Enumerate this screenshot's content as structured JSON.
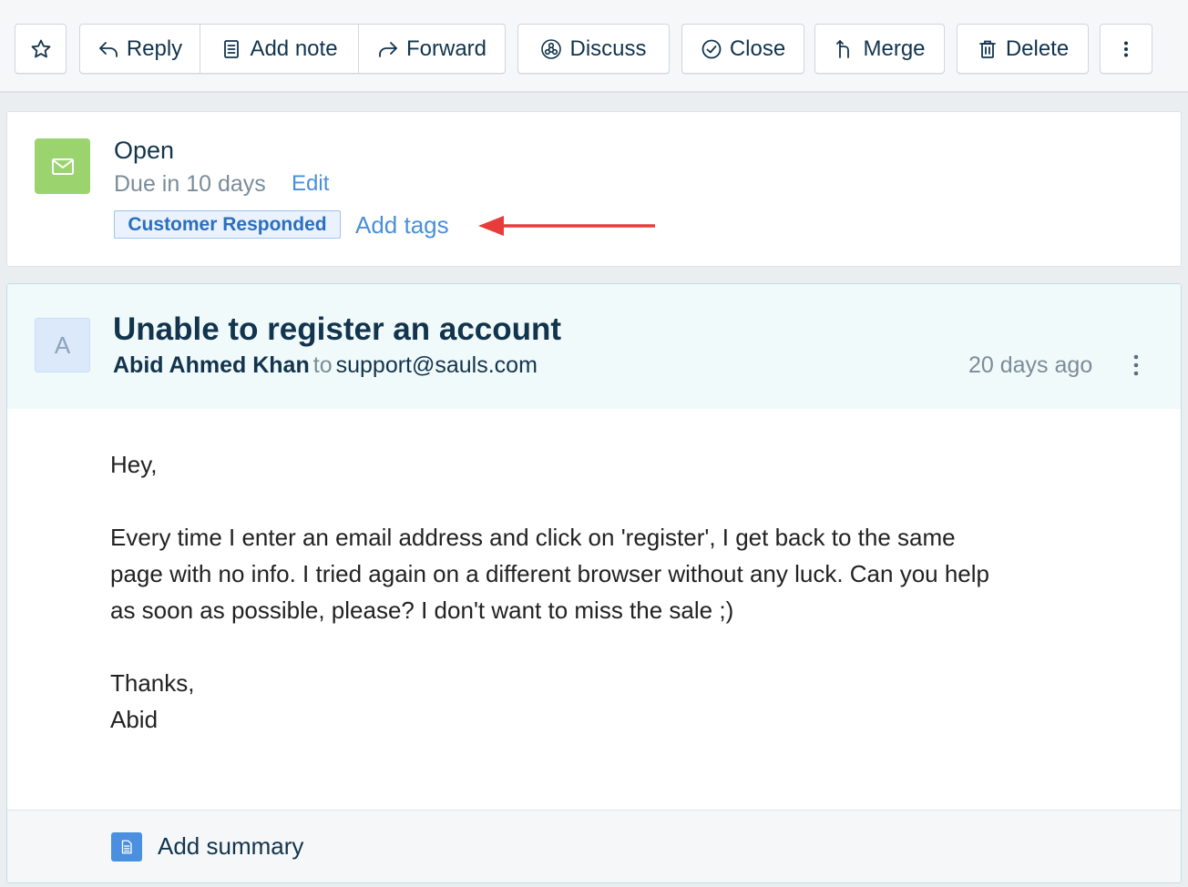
{
  "toolbar": {
    "star_icon": "star-icon",
    "reply_label": "Reply",
    "add_note_label": "Add note",
    "forward_label": "Forward",
    "discuss_label": "Discuss",
    "close_label": "Close",
    "merge_label": "Merge",
    "delete_label": "Delete",
    "more_icon": "more-vertical-icon"
  },
  "status": {
    "title": "Open",
    "due": "Due in 10 days",
    "edit_label": "Edit",
    "tag": "Customer Responded",
    "add_tags_label": "Add tags",
    "icon_color": "#9bd46f",
    "annotation_arrow_color": "#e83c3c"
  },
  "conversation": {
    "avatar_initial": "A",
    "subject": "Unable to register an account",
    "from_name": "Abid Ahmed Khan",
    "to_word": "to",
    "to_address": "support@sauls.com",
    "time_ago": "20 days ago",
    "body": {
      "greeting": "Hey,",
      "line1": "Every time I enter an email address and click on 'register', I get back to the same",
      "line2": "page with no info. I tried again on a different browser without any luck. Can you help",
      "line3": "as soon as possible, please? I don't want to miss the sale ;)",
      "thanks": "Thanks,",
      "signature": "Abid"
    },
    "add_summary_label": "Add summary"
  }
}
